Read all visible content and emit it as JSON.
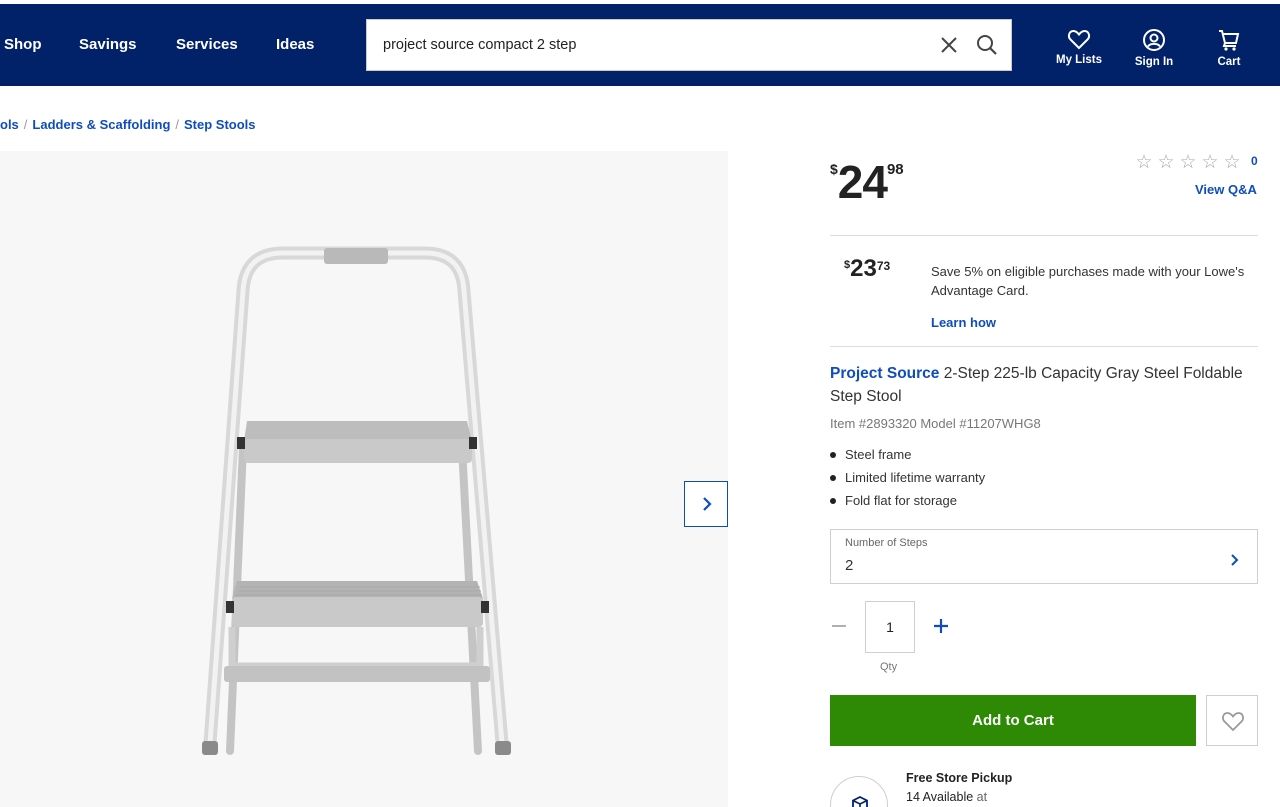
{
  "header": {
    "nav": [
      "Shop",
      "Savings",
      "Services",
      "Ideas"
    ],
    "search": {
      "value": "project source compact 2 step"
    },
    "actions": {
      "my_lists": "My Lists",
      "sign_in": "Sign In",
      "cart": "Cart"
    },
    "background_color": "#012169"
  },
  "breadcrumb": [
    "ols",
    "Ladders & Scaffolding",
    "Step Stools"
  ],
  "gallery": {
    "next_icon": "chevron-right-icon"
  },
  "price": {
    "currency": "$",
    "dollars": "24",
    "cents": "98"
  },
  "rating": {
    "stars_filled": 0,
    "stars_total": 5,
    "review_count": "0",
    "view_qa": "View Q&A"
  },
  "advantage": {
    "currency": "$",
    "dollars": "23",
    "cents": "73",
    "text": "Save 5% on eligible purchases made with your Lowe's Advantage Card.",
    "learn_how": "Learn how"
  },
  "product": {
    "brand": "Project Source",
    "title_rest": " 2-Step 225-lb Capacity Gray Steel Foldable Step Stool",
    "item_model": "Item #2893320  Model #11207WHG8",
    "bullets": [
      "Steel frame",
      "Limited lifetime warranty",
      "Fold flat for storage"
    ]
  },
  "options": {
    "steps_label": "Number of Steps",
    "steps_value": "2"
  },
  "quantity": {
    "value": "1",
    "label": "Qty"
  },
  "cart": {
    "add_label": "Add to Cart",
    "button_color": "#2e8a04"
  },
  "pickup": {
    "title": "Free Store Pickup",
    "available": "14 Available",
    "at": "at"
  },
  "colors": {
    "link": "#0f4dbc",
    "star_empty": "#a8a8a8"
  }
}
